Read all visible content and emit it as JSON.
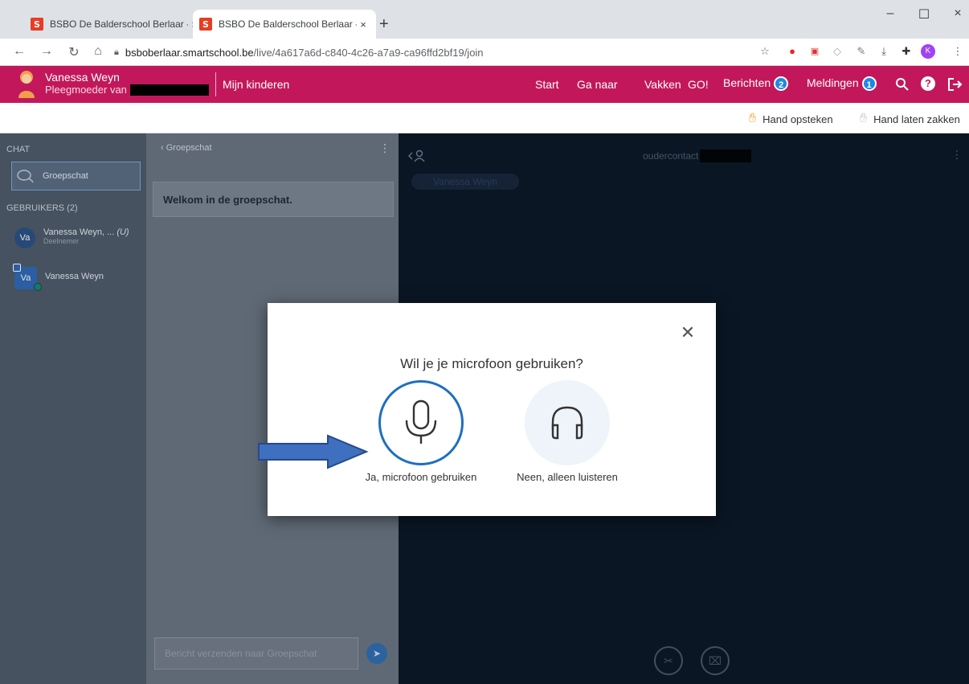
{
  "browser": {
    "tabs": [
      {
        "favicon": "S",
        "title": "BSBO De Balderschool Berlaar - S",
        "close": "×"
      },
      {
        "favicon": "S",
        "title": "BSBO De Balderschool Berlaar - S",
        "close": "×"
      }
    ],
    "new_tab": "+",
    "window_controls": {
      "minimize": "–",
      "maximize": "☐",
      "close": "×"
    },
    "url_host": "bsboberlaar.smartschool.be",
    "url_path": "/live/4a617a6d-c840-4c26-a7a9-ca96ffd2bf19/join",
    "profile_initial": "K"
  },
  "header": {
    "user_name": "Vanessa Weyn",
    "user_role": "Pleegmoeder van",
    "mijn_kinderen": "Mijn kinderen",
    "nav": {
      "start": "Start",
      "ga_naar": "Ga naar",
      "vakken": "Vakken",
      "go": "GO!",
      "berichten": "Berichten",
      "berichten_count": "2",
      "meldingen": "Meldingen",
      "meldingen_count": "1"
    }
  },
  "toolbar": {
    "raise_hand": "Hand opsteken",
    "lower_hand": "Hand laten zakken"
  },
  "sidebar": {
    "chat_label": "CHAT",
    "group_chat": "Groepschat",
    "users_label": "GEBRUIKERS (2)",
    "users": [
      {
        "initials": "Va",
        "name": "Vanessa Weyn, ...",
        "suffix": "(U)",
        "role": "Deelnemer"
      },
      {
        "initials": "Va",
        "name": "Vanessa Weyn"
      }
    ]
  },
  "chat": {
    "header": "Groepschat",
    "welcome": "Welkom in de groepschat.",
    "input_placeholder": "Bericht verzenden naar Groepschat"
  },
  "stage": {
    "title": "oudercontact",
    "presenter": "Vanessa Weyn"
  },
  "modal": {
    "question": "Wil je je microfoon gebruiken?",
    "option_mic": "Ja, microfoon gebruiken",
    "option_listen": "Neen, alleen luisteren"
  },
  "colors": {
    "brand": "#c2185b",
    "accent": "#1e6fc0",
    "stage_bg": "#0a1524"
  }
}
